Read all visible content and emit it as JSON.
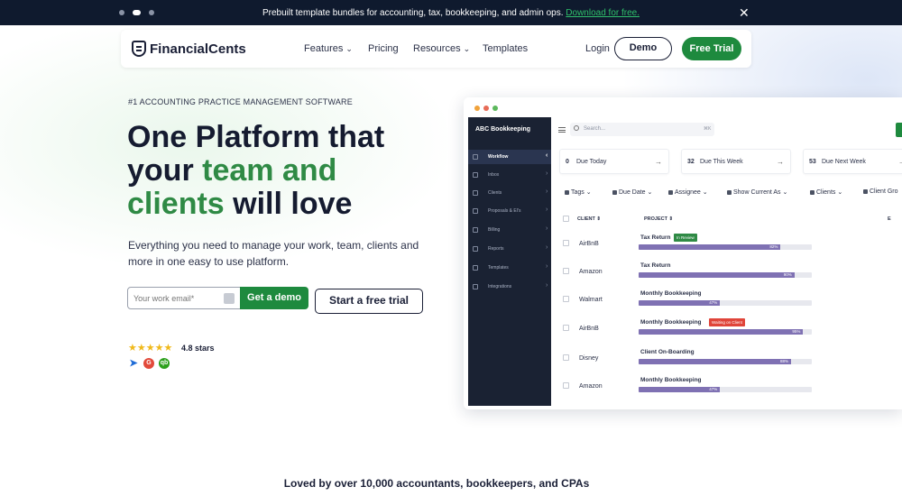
{
  "announcement": {
    "message": "Prebuilt template bundles for accounting, tax, bookkeeping, and admin ops.",
    "link": "Download for free.",
    "close_glyph": "✕"
  },
  "nav": {
    "logo": "FinancialCents",
    "items": [
      {
        "label": "Features",
        "has_dropdown": true
      },
      {
        "label": "Pricing",
        "has_dropdown": false
      },
      {
        "label": "Resources",
        "has_dropdown": true
      },
      {
        "label": "Templates",
        "has_dropdown": false
      }
    ],
    "chevron": "⌄",
    "login": "Login",
    "demo": "Demo",
    "free_trial": "Free Trial"
  },
  "hero": {
    "eyebrow": "#1 ACCOUNTING PRACTICE MANAGEMENT SOFTWARE",
    "headline_1": "One Platform that",
    "headline_2a": "your ",
    "headline_2b": "team and",
    "headline_3a": "clients",
    "headline_3b": " will love",
    "subtext": "Everything you need to manage your work, team, clients and more in one easy to use platform.",
    "email_placeholder": "Your work email*",
    "get_demo": "Get a demo",
    "start_trial": "Start a free trial",
    "stars": "★★★★★",
    "rating": "4.8 stars",
    "badges": [
      "Capterra",
      "G",
      "qb"
    ]
  },
  "loved_by": "Loved by over 10,000 accountants, bookkeepers, and CPAs",
  "app": {
    "colors": {
      "accent_green": "#1e8a3e",
      "sidebar_bg": "#1a2233",
      "progress_fill": "#7f71b3",
      "in_review": "#2f8a45",
      "waiting": "#e0453a"
    },
    "company": "ABC Bookkeeping",
    "sidebar_items": [
      "Workflow",
      "Inbox",
      "Clients",
      "Proposals & EI's",
      "Billing",
      "Reports",
      "Templates",
      "Integrations"
    ],
    "search_placeholder": "Search...",
    "search_shortcut": "⌘K",
    "due_cards": [
      {
        "count": "0",
        "label": "Due Today"
      },
      {
        "count": "32",
        "label": "Due This Week"
      },
      {
        "count": "53",
        "label": "Due Next Week"
      }
    ],
    "filters": [
      "Tags",
      "Due Date",
      "Assignee",
      "Show Current As",
      "Clients",
      "Client Gro"
    ],
    "columns": {
      "client": "CLIENT",
      "project": "PROJECT",
      "extra": "E"
    },
    "rows": [
      {
        "client": "AirBnB",
        "project": "Tax Return",
        "tag": "In Review",
        "progress": 82
      },
      {
        "client": "Amazon",
        "project": "Tax Return",
        "tag": "",
        "progress": 90
      },
      {
        "client": "Walmart",
        "project": "Monthly Bookkeeping",
        "tag": "",
        "progress": 47
      },
      {
        "client": "AirBnB",
        "project": "Monthly Bookkeeping",
        "tag": "Waiting on Client",
        "progress": 95
      },
      {
        "client": "Disney",
        "project": "Client On-Boarding",
        "tag": "",
        "progress": 88
      },
      {
        "client": "Amazon",
        "project": "Monthly Bookkeeping",
        "tag": "",
        "progress": 47
      }
    ]
  }
}
